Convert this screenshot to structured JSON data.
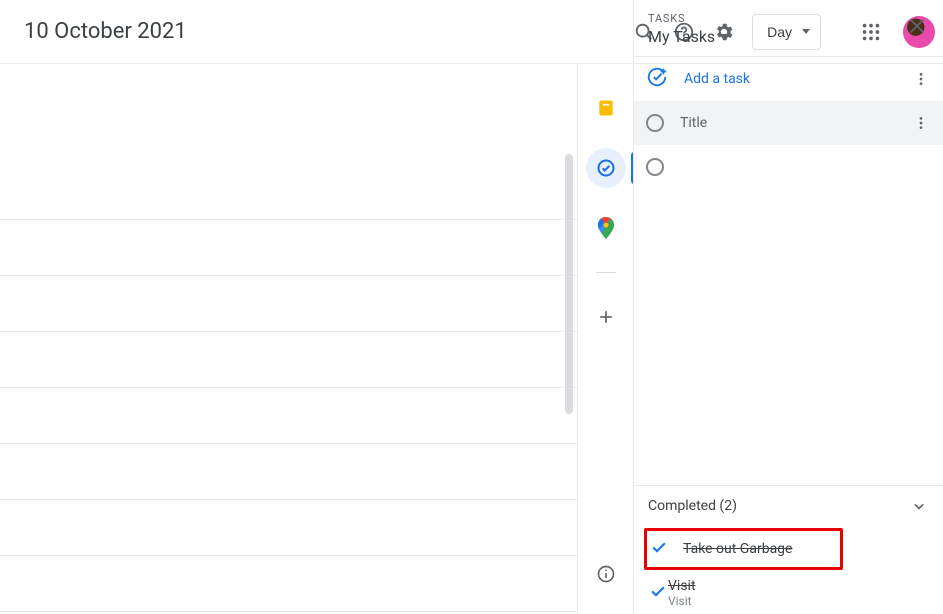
{
  "header": {
    "date_title": "10 October 2021",
    "view_label": "Day"
  },
  "tasks_panel": {
    "section_label": "TASKS",
    "list_name": "My Tasks",
    "add_task_label": "Add a task",
    "task_placeholder": "Title",
    "completed_header": "Completed (2)",
    "completed": [
      {
        "title": "Take out Garbage",
        "note": ""
      },
      {
        "title": "Visit",
        "note": "Visit"
      }
    ]
  }
}
